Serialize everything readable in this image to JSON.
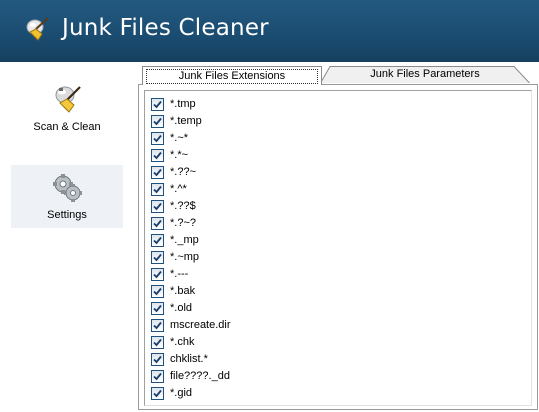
{
  "app": {
    "title": "Junk Files Cleaner"
  },
  "sidebar": {
    "items": [
      {
        "label": "Scan & Clean",
        "icon": "broom-icon",
        "active": false
      },
      {
        "label": "Settings",
        "icon": "gears-icon",
        "active": true
      }
    ]
  },
  "tabs": [
    {
      "label": "Junk Files Extensions",
      "active": true
    },
    {
      "label": "Junk Files Parameters",
      "active": false
    }
  ],
  "extensions": [
    {
      "label": "*.tmp",
      "checked": true
    },
    {
      "label": "*.temp",
      "checked": true
    },
    {
      "label": "*.~*",
      "checked": true
    },
    {
      "label": "*.*~",
      "checked": true
    },
    {
      "label": "*.??~",
      "checked": true
    },
    {
      "label": "*.^*",
      "checked": true
    },
    {
      "label": "*.??$",
      "checked": true
    },
    {
      "label": "*.?~?",
      "checked": true
    },
    {
      "label": "*._mp",
      "checked": true
    },
    {
      "label": "*.~mp",
      "checked": true
    },
    {
      "label": "*.---",
      "checked": true
    },
    {
      "label": "*.bak",
      "checked": true
    },
    {
      "label": "*.old",
      "checked": true
    },
    {
      "label": "mscreate.dir",
      "checked": true
    },
    {
      "label": "*.chk",
      "checked": true
    },
    {
      "label": "chklist.*",
      "checked": true
    },
    {
      "label": "file????._dd",
      "checked": true
    },
    {
      "label": "*.gid",
      "checked": true
    }
  ],
  "colors": {
    "header": "#1b4d72",
    "active_nav": "#eef2f6",
    "checkbox_border": "#1c5180",
    "check": "#1a3d6e"
  }
}
